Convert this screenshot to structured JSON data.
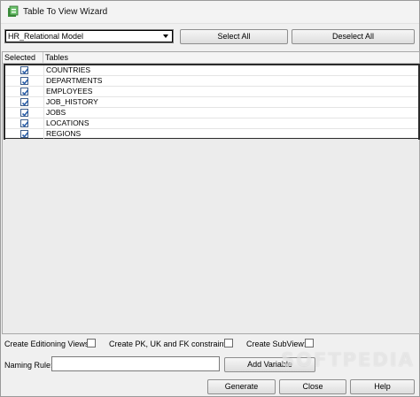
{
  "window": {
    "title": "Table To View Wizard"
  },
  "toolbar": {
    "model_selected": "HR_Relational Model",
    "select_all_label": "Select All",
    "deselect_all_label": "Deselect All"
  },
  "grid": {
    "columns": [
      "Selected",
      "Tables"
    ],
    "rows": [
      {
        "name": "COUNTRIES",
        "checked": true
      },
      {
        "name": "DEPARTMENTS",
        "checked": true
      },
      {
        "name": "EMPLOYEES",
        "checked": true
      },
      {
        "name": "JOB_HISTORY",
        "checked": true
      },
      {
        "name": "JOBS",
        "checked": true
      },
      {
        "name": "LOCATIONS",
        "checked": true
      },
      {
        "name": "REGIONS",
        "checked": true
      }
    ]
  },
  "options": {
    "editioning_views_label": "Create Editioning Views:",
    "constraints_label": "Create PK, UK and FK constraints:",
    "subview_label": "Create SubView:"
  },
  "naming": {
    "label": "Naming Rule:",
    "value": "",
    "add_variable_label": "Add Variable"
  },
  "footer": {
    "generate_label": "Generate",
    "close_label": "Close",
    "help_label": "Help"
  },
  "watermark": "SOFTPEDIA",
  "colors": {
    "check_blue": "#2a5ea8",
    "border_dark": "#2b2b2b"
  }
}
